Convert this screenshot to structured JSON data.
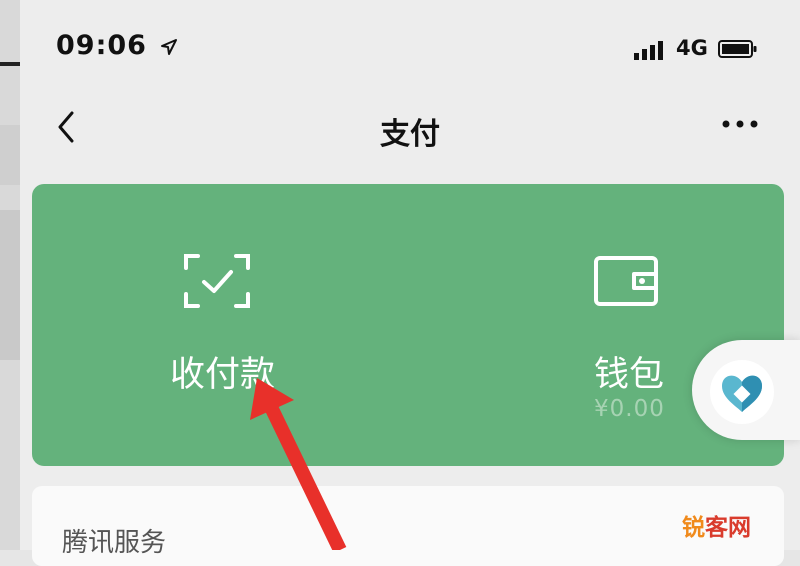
{
  "status_bar": {
    "time": "09:06",
    "network": "4G"
  },
  "nav": {
    "title": "支付"
  },
  "card": {
    "collect_pay_label": "收付款",
    "wallet_label": "钱包",
    "wallet_amount": "¥0.00"
  },
  "services": {
    "title": "腾讯服务"
  },
  "watermark": {
    "part1": "锐",
    "part2": "客网"
  },
  "colors": {
    "card_green": "#64b27c",
    "annotation_arrow": "#e8302a"
  }
}
